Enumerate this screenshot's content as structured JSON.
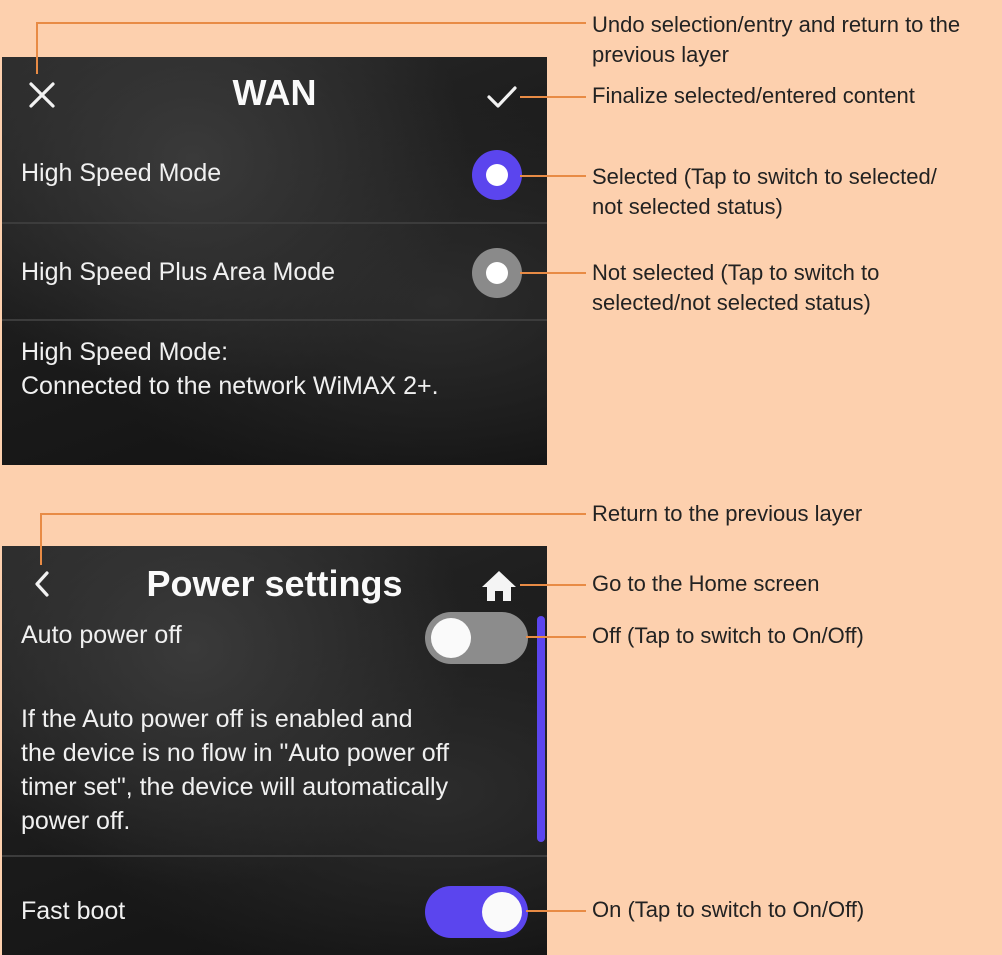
{
  "wan": {
    "title": "WAN",
    "items": [
      {
        "label": "High Speed Mode",
        "selected": true
      },
      {
        "label": "High Speed Plus Area Mode",
        "selected": false
      }
    ],
    "description_line1": "High Speed Mode:",
    "description_line2": "Connected to the network WiMAX 2+.",
    "icons": {
      "left": "close-icon",
      "right": "check-icon"
    }
  },
  "power": {
    "title": "Power settings",
    "auto_power_off": {
      "label": "Auto power off",
      "on": false
    },
    "description_lines": [
      "If the Auto power off is enabled and",
      "the device is no flow in \"Auto power off",
      "timer set\", the device will automatically",
      "power off."
    ],
    "fast_boot": {
      "label": "Fast boot",
      "on": true
    },
    "icons": {
      "left": "back-chevron-icon",
      "right": "home-icon"
    }
  },
  "callouts": {
    "undo_line1": "Undo selection/entry and return to the",
    "undo_line2": "previous layer",
    "finalize": "Finalize selected/entered content",
    "selected_line1": "Selected (Tap to switch to selected/",
    "selected_line2": "not selected status)",
    "not_selected_line1": "Not selected (Tap to switch to",
    "not_selected_line2": "selected/not selected status)",
    "return": "Return to the previous layer",
    "home": "Go to the Home screen",
    "off": "Off (Tap to switch to On/Off)",
    "on": "On (Tap to switch to On/Off)"
  },
  "colors": {
    "background": "#fdd0ae",
    "accent": "#5b45ee",
    "callout_line": "#e88b45",
    "screen": "#1c1c1c"
  }
}
